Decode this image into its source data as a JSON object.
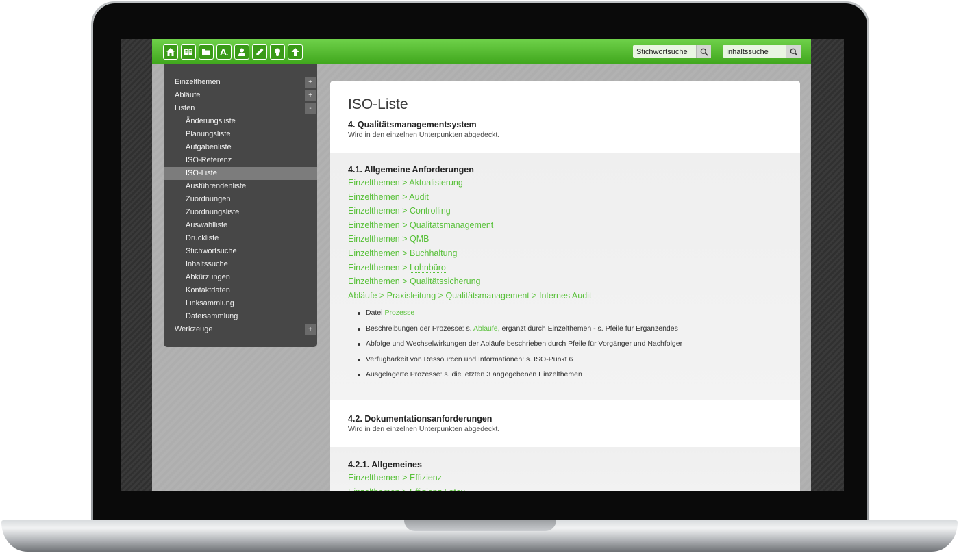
{
  "toolbar": {
    "icons": [
      "home-icon",
      "book-icon",
      "folder-icon",
      "abbreviation-icon",
      "person-icon",
      "pencil-icon",
      "lightbulb-icon",
      "arrow-up-icon"
    ],
    "accent": "#4cb82a"
  },
  "search": {
    "keyword_placeholder": "Stichwortsuche",
    "content_placeholder": "Inhaltssuche"
  },
  "sidebar": {
    "items": [
      {
        "label": "Einzelthemen",
        "toggle": "+"
      },
      {
        "label": "Abläufe",
        "toggle": "+"
      },
      {
        "label": "Listen",
        "toggle": "-"
      },
      {
        "label": "Änderungsliste"
      },
      {
        "label": "Planungsliste"
      },
      {
        "label": "Aufgabenliste"
      },
      {
        "label": "ISO-Referenz"
      },
      {
        "label": "ISO-Liste",
        "active": true
      },
      {
        "label": "Ausführendenliste"
      },
      {
        "label": "Zuordnungen"
      },
      {
        "label": "Zuordnungsliste"
      },
      {
        "label": "Auswahlliste"
      },
      {
        "label": "Druckliste"
      },
      {
        "label": "Stichwortsuche"
      },
      {
        "label": "Inhaltssuche"
      },
      {
        "label": "Abkürzungen"
      },
      {
        "label": "Kontaktdaten"
      },
      {
        "label": "Linksammlung"
      },
      {
        "label": "Dateisammlung"
      },
      {
        "label": "Werkzeuge",
        "toggle": "+"
      }
    ]
  },
  "content": {
    "title": "ISO-Liste",
    "s4": {
      "heading": "4. Qualitätsmanagementsystem",
      "desc": "Wird in den einzelnen Unterpunkten abgedeckt."
    },
    "s41": {
      "heading": "4.1. Allgemeine Anforderungen",
      "links": [
        "Einzelthemen > Aktualisierung",
        "Einzelthemen > Audit",
        "Einzelthemen > Controlling",
        "Einzelthemen > Qualitätsmanagement",
        "Einzelthemen > ",
        "QMB",
        "Einzelthemen > Buchhaltung",
        "Einzelthemen > ",
        "Lohnbüro",
        "Einzelthemen > Qualitätssicherung",
        "Abläufe > Praxisleitung > Qualitätsmanagement > Internes Audit"
      ],
      "bullets": {
        "b1_text": "Datei ",
        "b1_link": "Prozesse",
        "b2_a": "Beschreibungen der Prozesse: s. ",
        "b2_link": "Abläufe,",
        "b2_b": " ergänzt durch Einzelthemen - s. Pfeile für Ergänzendes",
        "b3": "Abfolge und Wechselwirkungen der Abläufe beschrieben durch Pfeile für Vorgänger und Nachfolger",
        "b4": "Verfügbarkeit von Ressourcen und Informationen: s. ISO-Punkt 6",
        "b5": "Ausgelagerte Prozesse: s. die letzten 3 angegebenen Einzelthemen"
      }
    },
    "s42": {
      "heading": "4.2. Dokumentationsanforderungen",
      "desc": "Wird in den einzelnen Unterpunkten abgedeckt."
    },
    "s421": {
      "heading": "4.2.1. Allgemeines",
      "links": [
        "Einzelthemen > Effizienz",
        "Einzelthemen > Effizienz Latex"
      ]
    }
  }
}
